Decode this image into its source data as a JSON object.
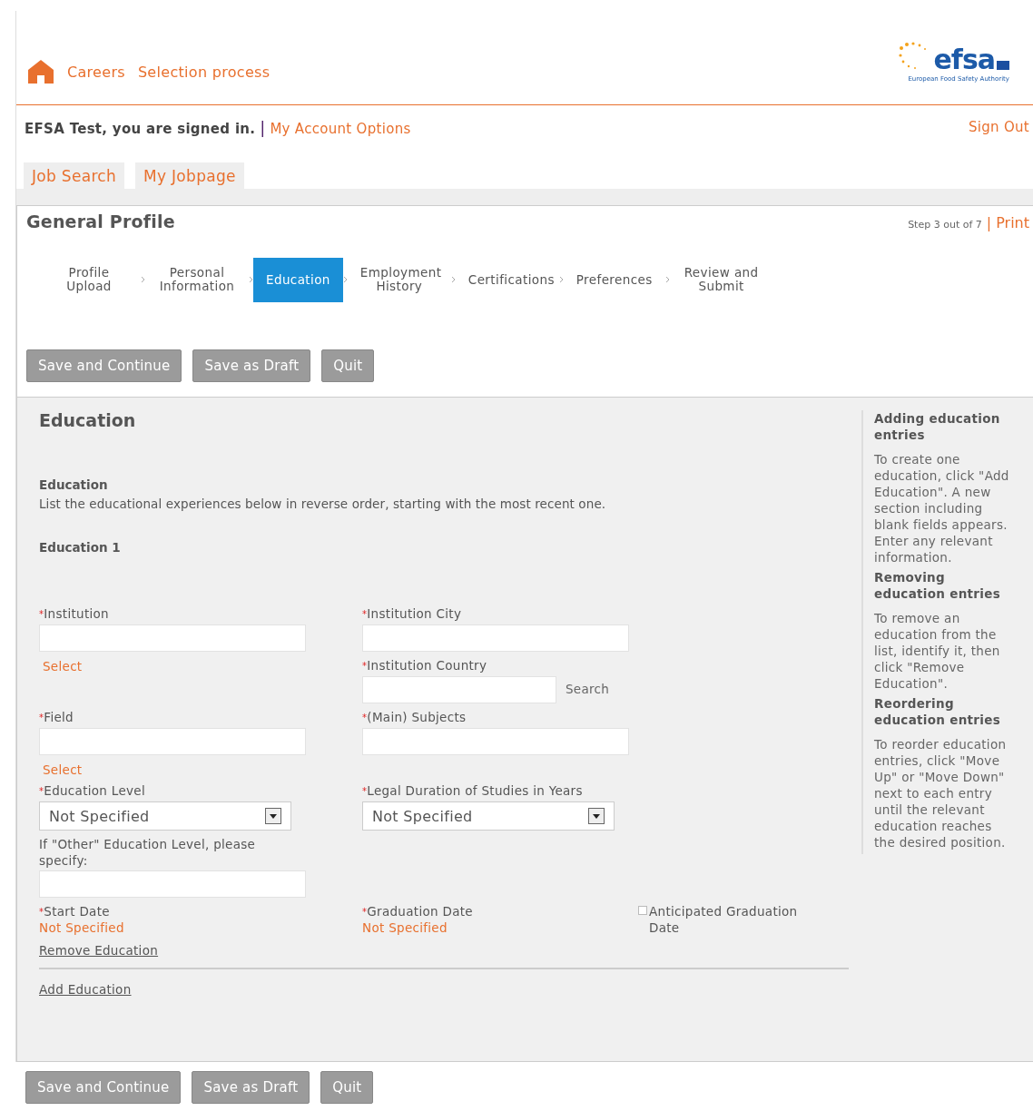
{
  "header": {
    "nav": [
      {
        "label": "Careers"
      },
      {
        "label": "Selection process"
      }
    ],
    "logo": {
      "name": "efsa",
      "tagline": "European Food Safety Authority"
    }
  },
  "account": {
    "greeting": "EFSA Test, you are signed in.",
    "separator": "|",
    "link": "My Account Options",
    "sign_out": "Sign Out"
  },
  "tabs": [
    {
      "label": "Job Search",
      "selected": false
    },
    {
      "label": "My Jobpage",
      "selected": false
    }
  ],
  "profile": {
    "title": "General Profile",
    "step": "Step 3 out of 7",
    "separator": "|",
    "print": "Print",
    "steps": [
      {
        "label": "Profile Upload",
        "selected": false
      },
      {
        "label": "Personal Information",
        "selected": false
      },
      {
        "label": "Education",
        "selected": true
      },
      {
        "label": "Employment History",
        "selected": false
      },
      {
        "label": "Certifications",
        "selected": false
      },
      {
        "label": "Preferences",
        "selected": false
      },
      {
        "label": "Review and Submit",
        "selected": false
      }
    ],
    "buttons": [
      "Save and Continue",
      "Save as Draft",
      "Quit"
    ]
  },
  "education": {
    "title": "Education",
    "subtitle": "Education",
    "description": "List the educational experiences below in reverse order, starting with the most recent one.",
    "entry_title": "Education 1",
    "required_mark": "*",
    "rows": [
      {
        "columns": [
          [
            {
              "kind": "text",
              "label": "Institution",
              "required": true,
              "link": "Select"
            }
          ],
          [
            {
              "kind": "text",
              "label": "Institution City",
              "required": true
            },
            {
              "kind": "text",
              "label": "Institution Country",
              "required": true,
              "action": "Search"
            }
          ]
        ]
      },
      {
        "columns": [
          [
            {
              "kind": "text",
              "label": "Field",
              "required": true,
              "link": "Select"
            }
          ],
          [
            {
              "kind": "text",
              "label": "(Main) Subjects",
              "required": true
            }
          ]
        ]
      },
      {
        "columns": [
          [
            {
              "kind": "select",
              "label": "Education Level",
              "required": true,
              "value": "Not Specified"
            },
            {
              "kind": "text",
              "label": "If \"Other\" Education Level, please specify:",
              "required": false
            }
          ],
          [
            {
              "kind": "select",
              "label": "Legal Duration of Studies in Years",
              "required": true,
              "value": "Not Specified"
            }
          ]
        ]
      },
      {
        "columns": [
          [
            {
              "kind": "date",
              "label": "Start Date",
              "required": true,
              "value": "Not Specified"
            }
          ],
          [
            {
              "kind": "date",
              "label": "Graduation Date",
              "required": true,
              "value": "Not Specified"
            }
          ],
          [
            {
              "kind": "checkbox",
              "label": "Anticipated Graduation Date",
              "checked": false
            }
          ]
        ]
      }
    ],
    "remove_link": "Remove Education",
    "add_link": "Add Education"
  },
  "help": [
    {
      "heading": "Adding education entries",
      "text": "To create one education, click \"Add Education\". A new section including blank fields appears. Enter any relevant information."
    },
    {
      "heading": "Removing education entries",
      "text": "To remove an education from the list, identify it, then click \"Remove Education\"."
    },
    {
      "heading": "Reordering education entries",
      "text": "To reorder education entries, click \"Move Up\" or \"Move Down\" next to each entry until the relevant education reaches the desired position."
    }
  ],
  "bottom_buttons": [
    "Save and Continue",
    "Save as Draft",
    "Quit"
  ]
}
